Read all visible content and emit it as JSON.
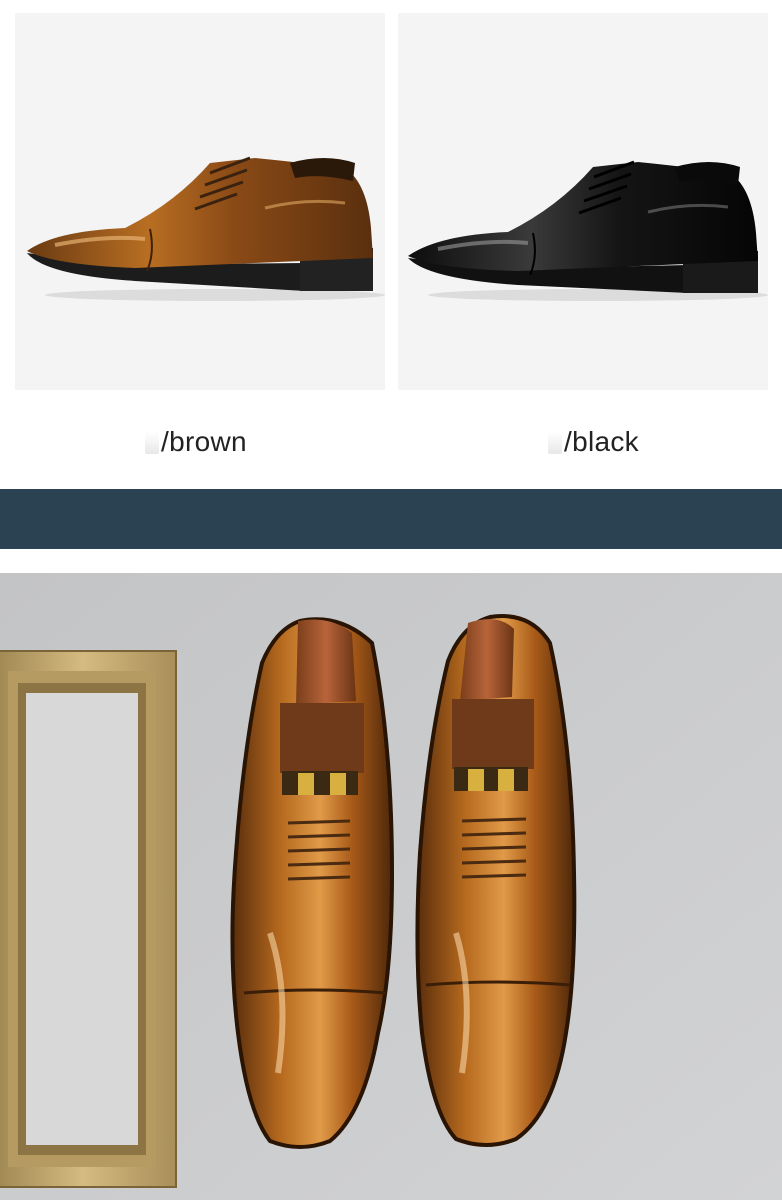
{
  "variants": [
    {
      "label": "/brown",
      "color": "#a8621c"
    },
    {
      "label": "/black",
      "color": "#1a1a1a"
    }
  ],
  "colors": {
    "band": "#2b4253",
    "card_background": "#f4f4f4",
    "lifestyle_wall": "#cbccce",
    "frame_gold": "#c2a66a"
  }
}
